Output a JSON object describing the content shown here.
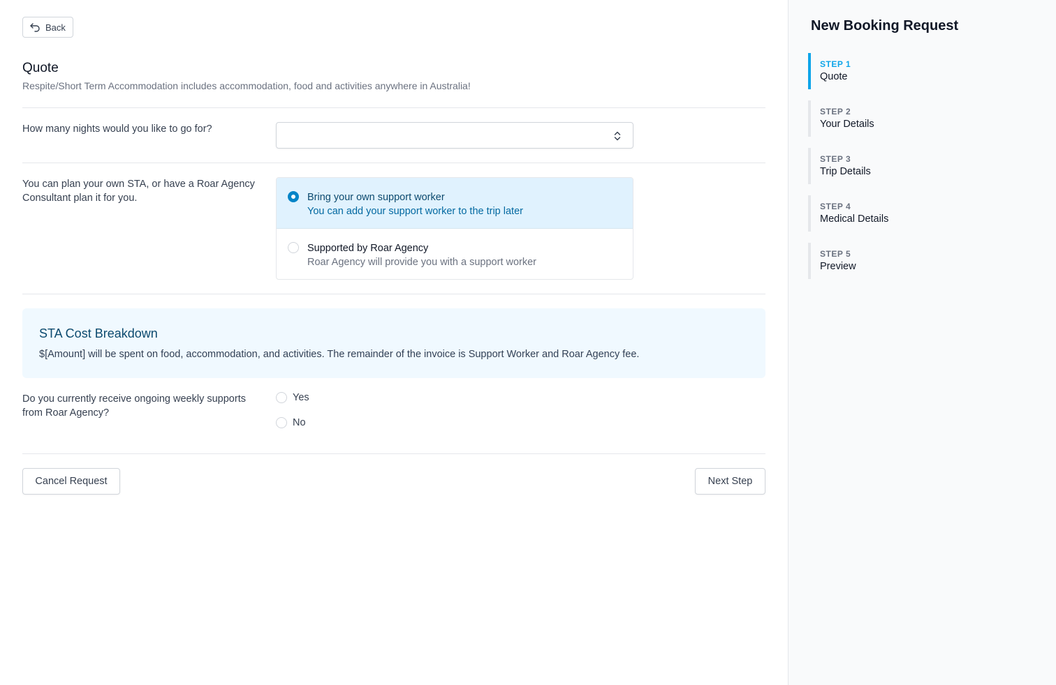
{
  "back": {
    "label": "Back"
  },
  "header": {
    "title": "Quote",
    "subtitle": "Respite/Short Term Accommodation includes accommodation, food and activities anywhere in Australia!"
  },
  "nights": {
    "question": "How many nights would you like to go for?",
    "value": ""
  },
  "planning": {
    "question": "You can plan your own STA, or have a Roar Agency Consultant plan it for you.",
    "options": [
      {
        "title": "Bring your own support worker",
        "description": "You can add your support worker to the trip later",
        "selected": true
      },
      {
        "title": "Supported by Roar Agency",
        "description": "Roar Agency will provide you with a support worker",
        "selected": false
      }
    ]
  },
  "cost": {
    "title": "STA Cost Breakdown",
    "text": "$[Amount] will be spent on food, accommodation, and activities. The remainder of the invoice is Support Worker and Roar Agency fee."
  },
  "weekly": {
    "question": "Do you currently receive ongoing weekly supports from Roar Agency?",
    "options": [
      "Yes",
      "No"
    ]
  },
  "actions": {
    "cancel": "Cancel Request",
    "next": "Next Step"
  },
  "sidebar": {
    "title": "New Booking Request",
    "steps": [
      {
        "num": "STEP 1",
        "name": "Quote",
        "active": true
      },
      {
        "num": "STEP 2",
        "name": "Your Details",
        "active": false
      },
      {
        "num": "STEP 3",
        "name": "Trip Details",
        "active": false
      },
      {
        "num": "STEP 4",
        "name": "Medical Details",
        "active": false
      },
      {
        "num": "STEP 5",
        "name": "Preview",
        "active": false
      }
    ]
  },
  "colors": {
    "accent": "#0ea5e9",
    "selected_bg": "#e0f2fe",
    "info_bg": "#f0f9ff"
  }
}
